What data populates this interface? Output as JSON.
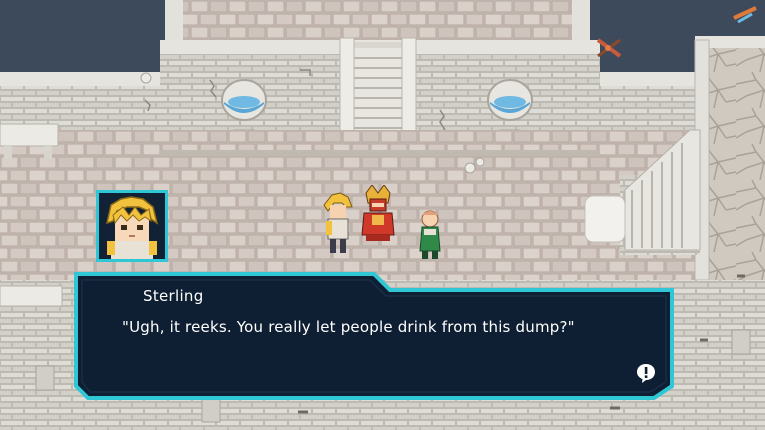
{
  "scene": {
    "location_icon": "crossed-tools-icon",
    "colors": {
      "water": "#3c4a5c",
      "floor": "#c9bdb4",
      "wall": "#d9d6cf",
      "dialog_bg": "#0f1f33",
      "dialog_border": "#2fc7d6",
      "text": "#ffffff"
    }
  },
  "party": [
    {
      "name_icon": "blonde-hero-sprite"
    },
    {
      "name_icon": "red-armored-knight-sprite"
    },
    {
      "name_icon": "green-robed-elder-sprite"
    }
  ],
  "dialog": {
    "speaker": "Sterling",
    "text": "\"Ugh, it reeks. You really let people drink from this dump?\"",
    "portrait_icon": "sterling-portrait-icon",
    "advance_icon": "speech-bubble-exclamation-icon"
  }
}
